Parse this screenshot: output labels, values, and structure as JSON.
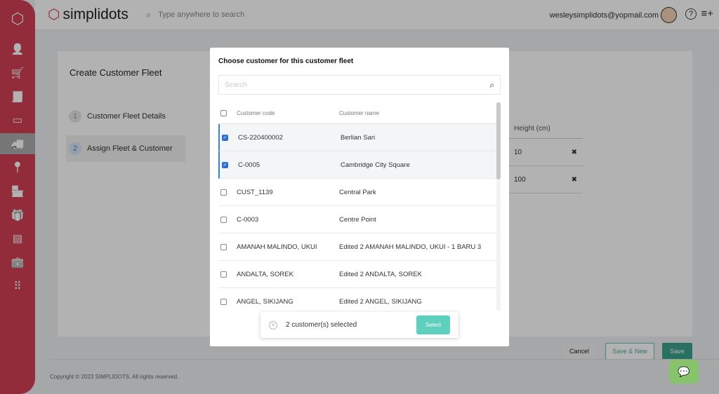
{
  "brand": {
    "name": "simplidots",
    "accent": "#d23f55"
  },
  "header": {
    "search_placeholder": "Type anywhere to search",
    "email": "wesleysimplidots@yopmail.com",
    "help": "?",
    "menu": "≡+"
  },
  "sidebar": {
    "items": [
      {
        "icon": "user-icon",
        "glyph": "👤"
      },
      {
        "icon": "cart-icon",
        "glyph": "🛒"
      },
      {
        "icon": "receipt-icon",
        "glyph": "🧾"
      },
      {
        "icon": "card-icon",
        "glyph": "▭"
      },
      {
        "icon": "truck-icon",
        "glyph": "🚚",
        "active": true
      },
      {
        "icon": "location-icon",
        "glyph": "📍"
      },
      {
        "icon": "store-search-icon",
        "glyph": "🏪"
      },
      {
        "icon": "gift-icon",
        "glyph": "🎁"
      },
      {
        "icon": "list-icon",
        "glyph": "▤"
      },
      {
        "icon": "briefcase-clock-icon",
        "glyph": "💼"
      },
      {
        "icon": "apps-grid-icon",
        "glyph": "⠿"
      }
    ]
  },
  "page": {
    "title": "Create Customer Fleet",
    "steps": [
      {
        "num": "1",
        "label": "Customer Fleet Details"
      },
      {
        "num": "2",
        "label": "Assign Fleet & Customer",
        "active": true
      }
    ],
    "dims": {
      "header": "Height (cm)",
      "rows": [
        "10",
        "100"
      ]
    },
    "buttons": {
      "cancel": "Cancel",
      "save_new": "Save & New",
      "save": "Save"
    },
    "footer": "Copyright © 2023 SIMPLIDOTS. All rights reserved."
  },
  "modal": {
    "title": "Choose customer for this customer fleet",
    "search_placeholder": "Search",
    "columns": [
      "Customer code",
      "Customer name"
    ],
    "rows": [
      {
        "code": "CS-220400002",
        "name": "Berlian Sari",
        "checked": true
      },
      {
        "code": "C-0005",
        "name": "Cambridge City Square",
        "checked": true
      },
      {
        "code": "CUST_1139",
        "name": "Central Park",
        "checked": false
      },
      {
        "code": "C-0003",
        "name": "Centre Point",
        "checked": false
      },
      {
        "code": "AMANAH MALINDO, UKUI",
        "name": "Edited 2 AMANAH MALINDO, UKUI - 1 BARU 3",
        "checked": false
      },
      {
        "code": "ANDALTA, SOREK",
        "name": "Edited 2 ANDALTA, SOREK",
        "checked": false
      },
      {
        "code": "ANGEL, SIKIJANG",
        "name": "Edited 2 ANGEL, SIKIJANG",
        "checked": false
      }
    ],
    "selection": {
      "text": "2 customer(s) selected",
      "button": "Select"
    }
  }
}
